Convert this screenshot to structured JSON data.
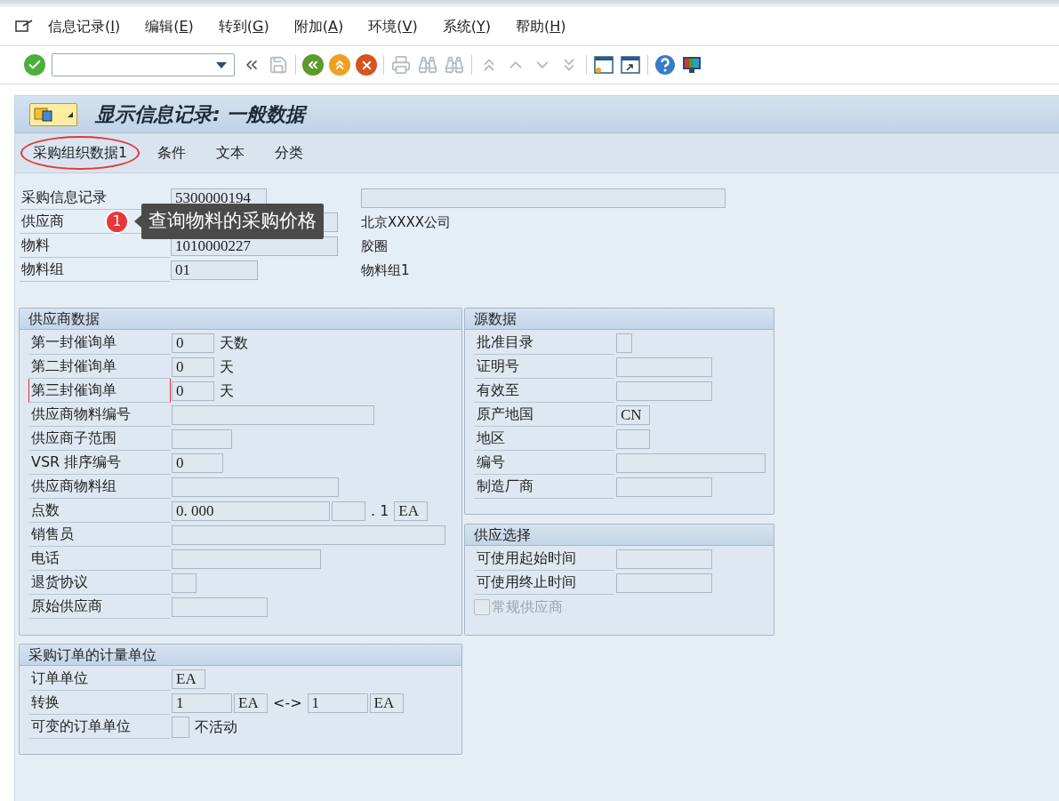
{
  "menu": [
    {
      "before": "信息记录(",
      "key": "I",
      "after": ")"
    },
    {
      "before": "编辑(",
      "key": "E",
      "after": ")"
    },
    {
      "before": "转到(",
      "key": "G",
      "after": ")"
    },
    {
      "before": "附加(",
      "key": "A",
      "after": ")"
    },
    {
      "before": "环境(",
      "key": "V",
      "after": ")"
    },
    {
      "before": "系统(",
      "key": "Y",
      "after": ")"
    },
    {
      "before": "帮助(",
      "key": "H",
      "after": ")"
    }
  ],
  "toolbar": [
    [
      {
        "kind": "enter",
        "disabled": false
      },
      {
        "kind": "command-field",
        "disabled": false
      },
      {
        "kind": "collapse",
        "disabled": false
      },
      {
        "kind": "save",
        "disabled": true
      }
    ],
    [
      {
        "kind": "back",
        "disabled": false
      },
      {
        "kind": "exit",
        "disabled": false
      },
      {
        "kind": "cancel",
        "disabled": false
      }
    ],
    [
      {
        "kind": "print",
        "disabled": true
      },
      {
        "kind": "find",
        "disabled": true
      },
      {
        "kind": "find-next",
        "disabled": true
      }
    ],
    [
      {
        "kind": "first-page",
        "disabled": true
      },
      {
        "kind": "prev-page",
        "disabled": true
      },
      {
        "kind": "next-page",
        "disabled": true
      },
      {
        "kind": "last-page",
        "disabled": true
      }
    ],
    [
      {
        "kind": "new-session",
        "disabled": false
      },
      {
        "kind": "shortcut",
        "disabled": false
      }
    ],
    [
      {
        "kind": "help",
        "disabled": false
      },
      {
        "kind": "layout",
        "disabled": false
      }
    ]
  ],
  "title": "显示信息记录: 一般数据",
  "app_buttons": [
    {
      "label": "采购组织数据1",
      "highlighted": true
    },
    {
      "label": "条件",
      "highlighted": false
    },
    {
      "label": "文本",
      "highlighted": false
    },
    {
      "label": "分类",
      "highlighted": false
    }
  ],
  "header": [
    {
      "label": "采购信息记录",
      "items": [
        {
          "kind": "field",
          "value": "5300000194"
        }
      ],
      "description": {
        "kind": "field"
      }
    },
    {
      "label": "供应商",
      "items": [
        {
          "kind": "field"
        }
      ],
      "description": {
        "kind": "text",
        "text": "北京XXXX公司"
      }
    },
    {
      "label": "物料",
      "items": [
        {
          "kind": "field",
          "value": "1010000227"
        }
      ],
      "description": {
        "kind": "text",
        "text": "胶圈"
      }
    },
    {
      "label": "物料组",
      "items": [
        {
          "kind": "field",
          "value": "01"
        }
      ],
      "description": {
        "kind": "text",
        "text": "物料组1"
      }
    }
  ],
  "callout": {
    "badge": "1",
    "text": "查询物料的采购价格"
  },
  "supplier_data": {
    "title": "供应商数据",
    "rows": [
      {
        "label": "第一封催询单",
        "focused": false,
        "items": [
          {
            "kind": "field",
            "value": "0"
          },
          {
            "kind": "text",
            "text": "天数"
          }
        ]
      },
      {
        "label": "第二封催询单",
        "focused": false,
        "items": [
          {
            "kind": "field",
            "value": "0"
          },
          {
            "kind": "text",
            "text": "天"
          }
        ]
      },
      {
        "label": "第三封催询单",
        "focused": true,
        "items": [
          {
            "kind": "field",
            "value": "0"
          },
          {
            "kind": "text",
            "text": "天"
          }
        ]
      },
      {
        "label": "供应商物料编号",
        "focused": false,
        "items": [
          {
            "kind": "field"
          }
        ]
      },
      {
        "label": "供应商子范围",
        "focused": false,
        "items": [
          {
            "kind": "field"
          }
        ]
      },
      {
        "label": "VSR 排序编号",
        "focused": false,
        "items": [
          {
            "kind": "field",
            "value": "0"
          }
        ]
      },
      {
        "label": "供应商物料组",
        "focused": false,
        "items": [
          {
            "kind": "field"
          }
        ]
      },
      {
        "label": "点数",
        "focused": false,
        "items": [
          {
            "kind": "field",
            "value": "0. 000"
          },
          {
            "kind": "field"
          },
          {
            "kind": "text",
            "text": ". 1"
          },
          {
            "kind": "field",
            "value": "EA"
          }
        ]
      },
      {
        "label": "销售员",
        "focused": false,
        "items": [
          {
            "kind": "field"
          }
        ]
      },
      {
        "label": "电话",
        "focused": false,
        "items": [
          {
            "kind": "field"
          }
        ]
      },
      {
        "label": "退货协议",
        "focused": false,
        "items": [
          {
            "kind": "field"
          }
        ]
      },
      {
        "label": "原始供应商",
        "focused": false,
        "items": [
          {
            "kind": "field"
          }
        ]
      }
    ]
  },
  "source_data": {
    "title": "源数据",
    "rows": [
      {
        "label": "批准目录",
        "focused": false,
        "items": [
          {
            "kind": "field"
          }
        ]
      },
      {
        "label": "证明号",
        "focused": false,
        "items": [
          {
            "kind": "field"
          }
        ]
      },
      {
        "label": "有效至",
        "focused": false,
        "items": [
          {
            "kind": "field"
          }
        ]
      },
      {
        "label": "原产地国",
        "focused": false,
        "items": [
          {
            "kind": "field",
            "value": "CN"
          }
        ]
      },
      {
        "label": "地区",
        "focused": false,
        "items": [
          {
            "kind": "field"
          }
        ]
      },
      {
        "label": "编号",
        "focused": false,
        "items": [
          {
            "kind": "field"
          }
        ]
      },
      {
        "label": "制造厂商",
        "focused": false,
        "items": [
          {
            "kind": "field"
          }
        ]
      }
    ]
  },
  "supply_selection": {
    "title": "供应选择",
    "rows": [
      {
        "label": "可使用起始时间",
        "focused": false,
        "items": [
          {
            "kind": "field"
          }
        ]
      },
      {
        "label": "可使用终止时间",
        "focused": false,
        "items": [
          {
            "kind": "field"
          }
        ]
      }
    ],
    "checkbox": {
      "label": "常规供应商",
      "checked": false,
      "disabled": true
    }
  },
  "order_unit": {
    "title": "采购订单的计量单位",
    "rows": [
      {
        "label": "订单单位",
        "focused": false,
        "items": [
          {
            "kind": "field",
            "value": "EA"
          }
        ]
      },
      {
        "label": "转换",
        "focused": false,
        "items": [
          {
            "kind": "field",
            "value": "1"
          },
          {
            "kind": "field",
            "value": "EA"
          },
          {
            "kind": "text",
            "text": "<->"
          },
          {
            "kind": "field",
            "value": "1"
          },
          {
            "kind": "field",
            "value": "EA"
          }
        ]
      },
      {
        "label": "可变的订单单位",
        "focused": false,
        "items": [
          {
            "kind": "checkbox",
            "checked": false
          },
          {
            "kind": "text",
            "text": "不活动"
          }
        ]
      }
    ]
  }
}
